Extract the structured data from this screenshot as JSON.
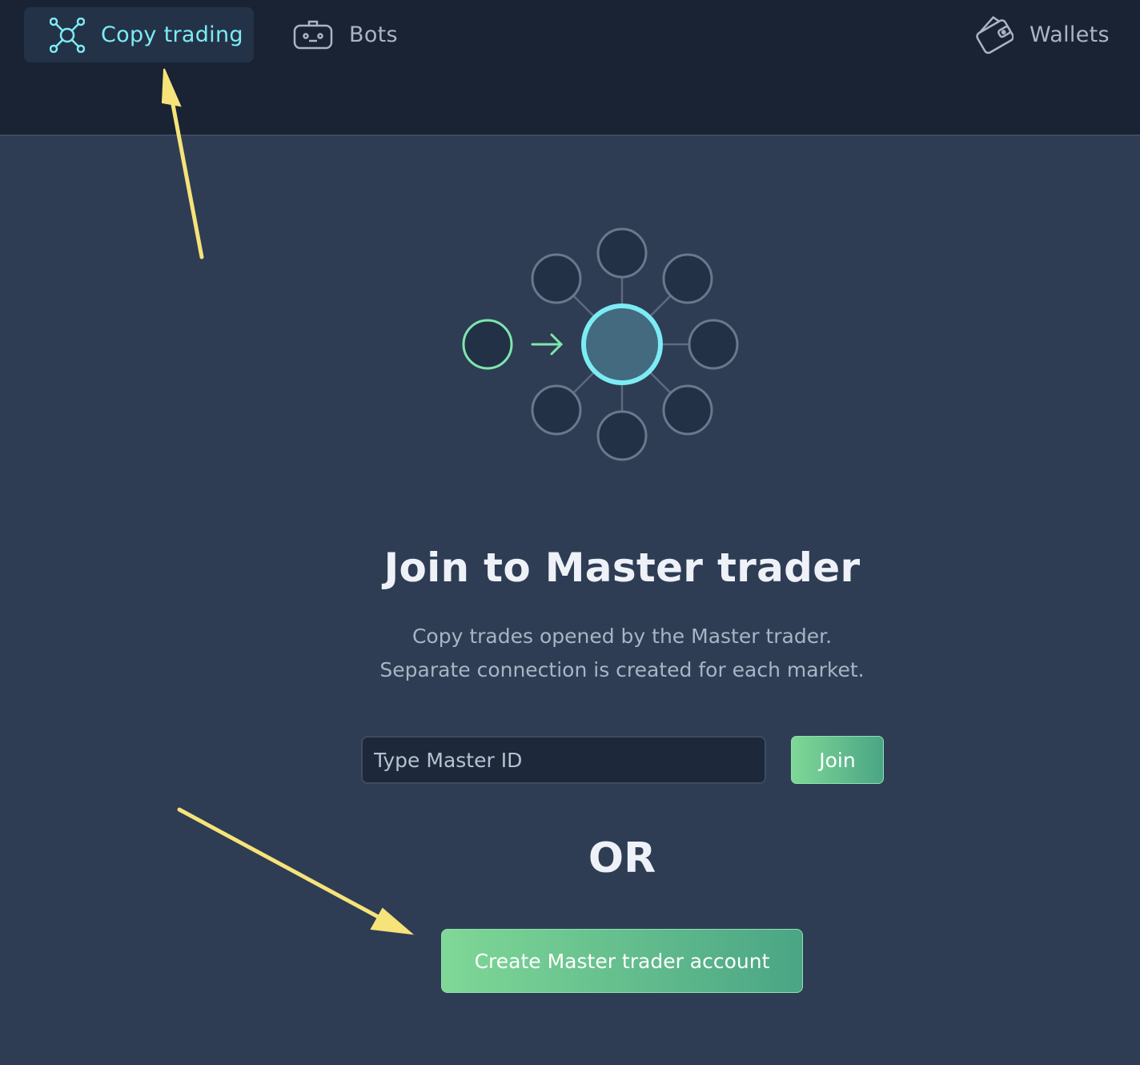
{
  "nav": {
    "items": [
      {
        "label": "Copy trading",
        "icon": "network-icon",
        "active": true
      },
      {
        "label": "Bots",
        "icon": "robot-icon",
        "active": false
      },
      {
        "label": "Wallets",
        "icon": "wallet-icon",
        "active": false
      }
    ]
  },
  "main": {
    "title": "Join to Master trader",
    "subtitle_line1": "Copy trades opened by the Master trader.",
    "subtitle_line2": "Separate connection is created for each market.",
    "master_id_placeholder": "Type Master ID",
    "join_label": "Join",
    "or_label": "OR",
    "create_label": "Create Master trader account"
  },
  "colors": {
    "accent_cyan": "#7cecf4",
    "accent_green": "#7fd896",
    "annotation_arrow": "#f6e37a"
  }
}
